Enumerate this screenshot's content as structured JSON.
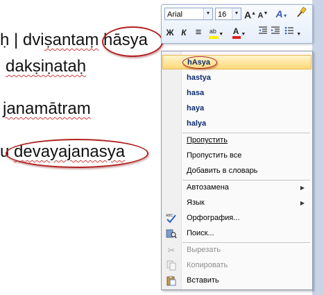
{
  "document": {
    "lines": [
      {
        "prefix": "ḥ | dvi",
        "squiggle": "ṣantaṃ",
        "space": " ",
        "word": "hāsya"
      },
      {
        "text": "dakṣiṇataḥ"
      },
      {
        "text": "janamātram"
      },
      {
        "prefix": "u ",
        "word": "devayajanasya"
      }
    ]
  },
  "mini_toolbar": {
    "font_name": "Arial",
    "font_size": "16",
    "buttons": [
      "A",
      "A",
      "A",
      "Ж",
      "К",
      "≡",
      "ab",
      "A"
    ],
    "colors": {
      "highlight": "#ffef00",
      "font": "#e0201a"
    }
  },
  "context_menu": {
    "suggestions": [
      "hAsya",
      "hastya",
      "hasa",
      "haya",
      "halya"
    ],
    "actions": {
      "skip": "Пропустить",
      "skip_all": "Пропустить все",
      "add_to_dictionary": "Добавить в словарь",
      "autocorrect": "Автозамена",
      "language": "Язык",
      "spelling": "Орфография...",
      "search": "Поиск...",
      "cut": "Вырезать",
      "copy": "Копировать",
      "paste": "Вставить"
    }
  },
  "colors": {
    "accent_highlight": "#ffd97a",
    "annotation": "#b02222",
    "menu_text_bold": "#0b2a6e"
  }
}
